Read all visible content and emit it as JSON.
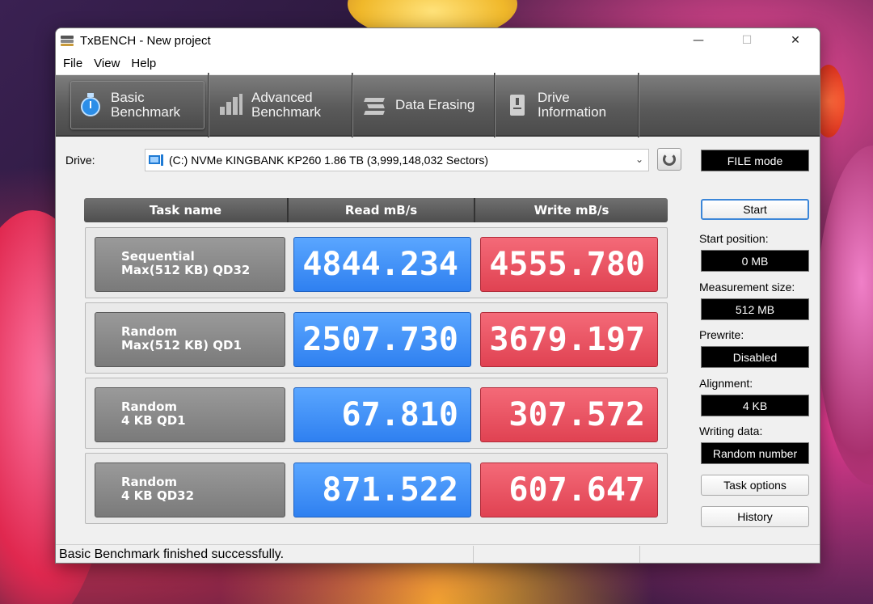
{
  "window": {
    "title": "TxBENCH - New project"
  },
  "window_controls": {
    "minimize": "—",
    "maximize": "☐",
    "close": "✕"
  },
  "menu": [
    "File",
    "View",
    "Help"
  ],
  "tabs": [
    {
      "line1": "Basic",
      "line2": "Benchmark",
      "icon": "stopwatch-icon",
      "active": true
    },
    {
      "line1": "Advanced",
      "line2": "Benchmark",
      "icon": "bar-chart-icon",
      "active": false
    },
    {
      "line1": "Data Erasing",
      "line2": "",
      "icon": "erase-icon",
      "active": false
    },
    {
      "line1": "Drive",
      "line2": "Information",
      "icon": "drive-info-icon",
      "active": false
    }
  ],
  "drive": {
    "label": "Drive:",
    "selected": "(C:) NVMe KINGBANK KP260  1.86 TB (3,999,148,032 Sectors)",
    "mode": "FILE mode"
  },
  "table": {
    "headers": [
      "Task name",
      "Read mB/s",
      "Write mB/s"
    ],
    "rows": [
      {
        "line1": "Sequential",
        "line2": "Max(512 KB) QD32",
        "read": "4844.234",
        "write": "4555.780"
      },
      {
        "line1": "Random",
        "line2": "Max(512 KB) QD1",
        "read": "2507.730",
        "write": "3679.197"
      },
      {
        "line1": "Random",
        "line2": "4 KB QD1",
        "read": "67.810",
        "write": "307.572"
      },
      {
        "line1": "Random",
        "line2": "4 KB QD32",
        "read": "871.522",
        "write": "607.647"
      }
    ]
  },
  "side": {
    "start_label": "Start",
    "start_position_label": "Start position:",
    "start_position_value": "0 MB",
    "measurement_size_label": "Measurement size:",
    "measurement_size_value": "512 MB",
    "prewrite_label": "Prewrite:",
    "prewrite_value": "Disabled",
    "alignment_label": "Alignment:",
    "alignment_value": "4 KB",
    "writing_data_label": "Writing data:",
    "writing_data_value": "Random number",
    "task_options_label": "Task options",
    "history_label": "History"
  },
  "status": {
    "message": "Basic Benchmark finished successfully."
  },
  "colors": {
    "read": "#2f80f0",
    "write": "#e04252",
    "toolbar": "#5a5a5a"
  }
}
